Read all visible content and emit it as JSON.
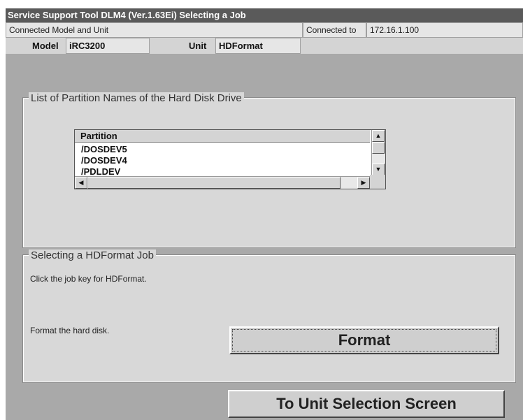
{
  "window": {
    "title": "Service Support Tool DLM4 (Ver.1.63Ei) Selecting a Job"
  },
  "connection": {
    "header_label": "Connected Model and Unit",
    "connected_to_label": "Connected to",
    "ip": "172.16.1.100",
    "model_label": "Model",
    "model_value": "iRC3200",
    "unit_label": "Unit",
    "unit_value": "HDFormat"
  },
  "partitions": {
    "group_title": "List of Partition Names of the Hard Disk Drive",
    "column_header": "Partition",
    "items": [
      "/DOSDEV5",
      "/DOSDEV4",
      "/PDLDEV"
    ]
  },
  "job": {
    "group_title": "Selecting a HDFormat Job",
    "instruction": "Click the job key for HDFormat.",
    "format_description": "Format the hard disk.",
    "format_button": "Format"
  },
  "footer": {
    "back_button": "To Unit Selection Screen"
  },
  "icons": {
    "up": "▲",
    "down": "▼",
    "left": "◀",
    "right": "▶"
  },
  "colors": {
    "titlebar": "#5a5a5a",
    "background": "#a9a9a9",
    "panel": "#d8d8d8"
  }
}
